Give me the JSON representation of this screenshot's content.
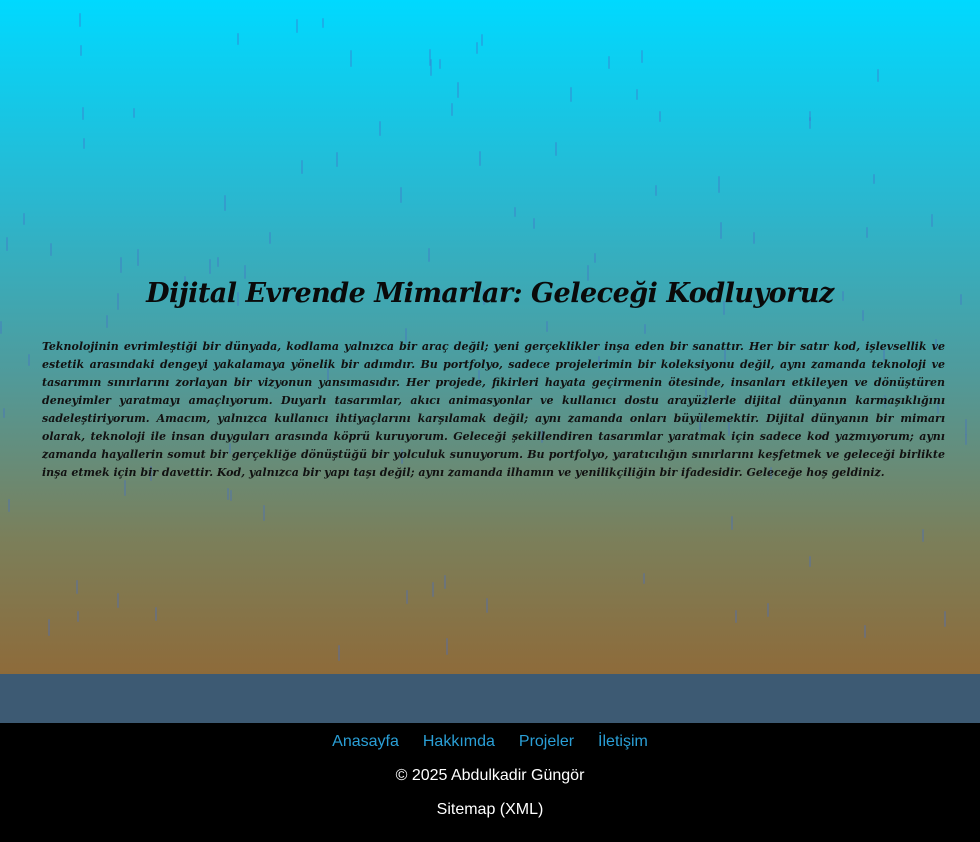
{
  "hero": {
    "title": "Dijital Evrende Mimarlar: Geleceği Kodluyoruz",
    "text": "Teknolojinin evrimleştiği bir dünyada, kodlama yalnızca bir araç değil; yeni gerçeklikler inşa eden bir sanattır. Her bir satır kod, işlevsellik ve estetik arasındaki dengeyi yakalamaya yönelik bir adımdır. Bu portfolyo, sadece projelerimin bir koleksiyonu değil, aynı zamanda teknoloji ve tasarımın sınırlarını zorlayan bir vizyonun yansımasıdır. Her projede, fikirleri hayata geçirmenin ötesinde, insanları etkileyen ve dönüştüren deneyimler yaratmayı amaçlıyorum. Duyarlı tasarımlar, akıcı animasyonlar ve kullanıcı dostu arayüzlerle dijital dünyanın karmaşıklığını sadeleştiriyorum. Amacım, yalnızca kullanıcı ihtiyaçlarını karşılamak değil; aynı zamanda onları büyülemektir. Dijital dünyanın bir mimarı olarak, teknoloji ile insan duyguları arasında köprü kuruyorum. Geleceği şekillendiren tasarımlar yaratmak için sadece kod yazmıyorum; aynı zamanda hayallerin somut bir gerçekliğe dönüştüğü bir yolculuk sunuyorum. Bu portfolyo, yaratıcılığın sınırlarını keşfetmek ve geleceği birlikte inşa etmek için bir davettir. Kod, yalnızca bir yapı taşı değil; aynı zamanda ilhamın ve yenilikçiliğin bir ifadesidir. Geleceğe hoş geldiniz."
  },
  "footer": {
    "nav": [
      {
        "label": "Anasayfa"
      },
      {
        "label": "Hakkımda"
      },
      {
        "label": "Projeler"
      },
      {
        "label": "İletişim"
      }
    ],
    "copyright": "© 2025 Abdulkadir Güngör",
    "sitemap": "Sitemap (XML)"
  },
  "colors": {
    "gradient_top": "#00d9ff",
    "gradient_bottom": "#8e6b3a",
    "strip": "#3d5a73",
    "footer_bg": "#000000",
    "link": "#2a9fd6"
  }
}
